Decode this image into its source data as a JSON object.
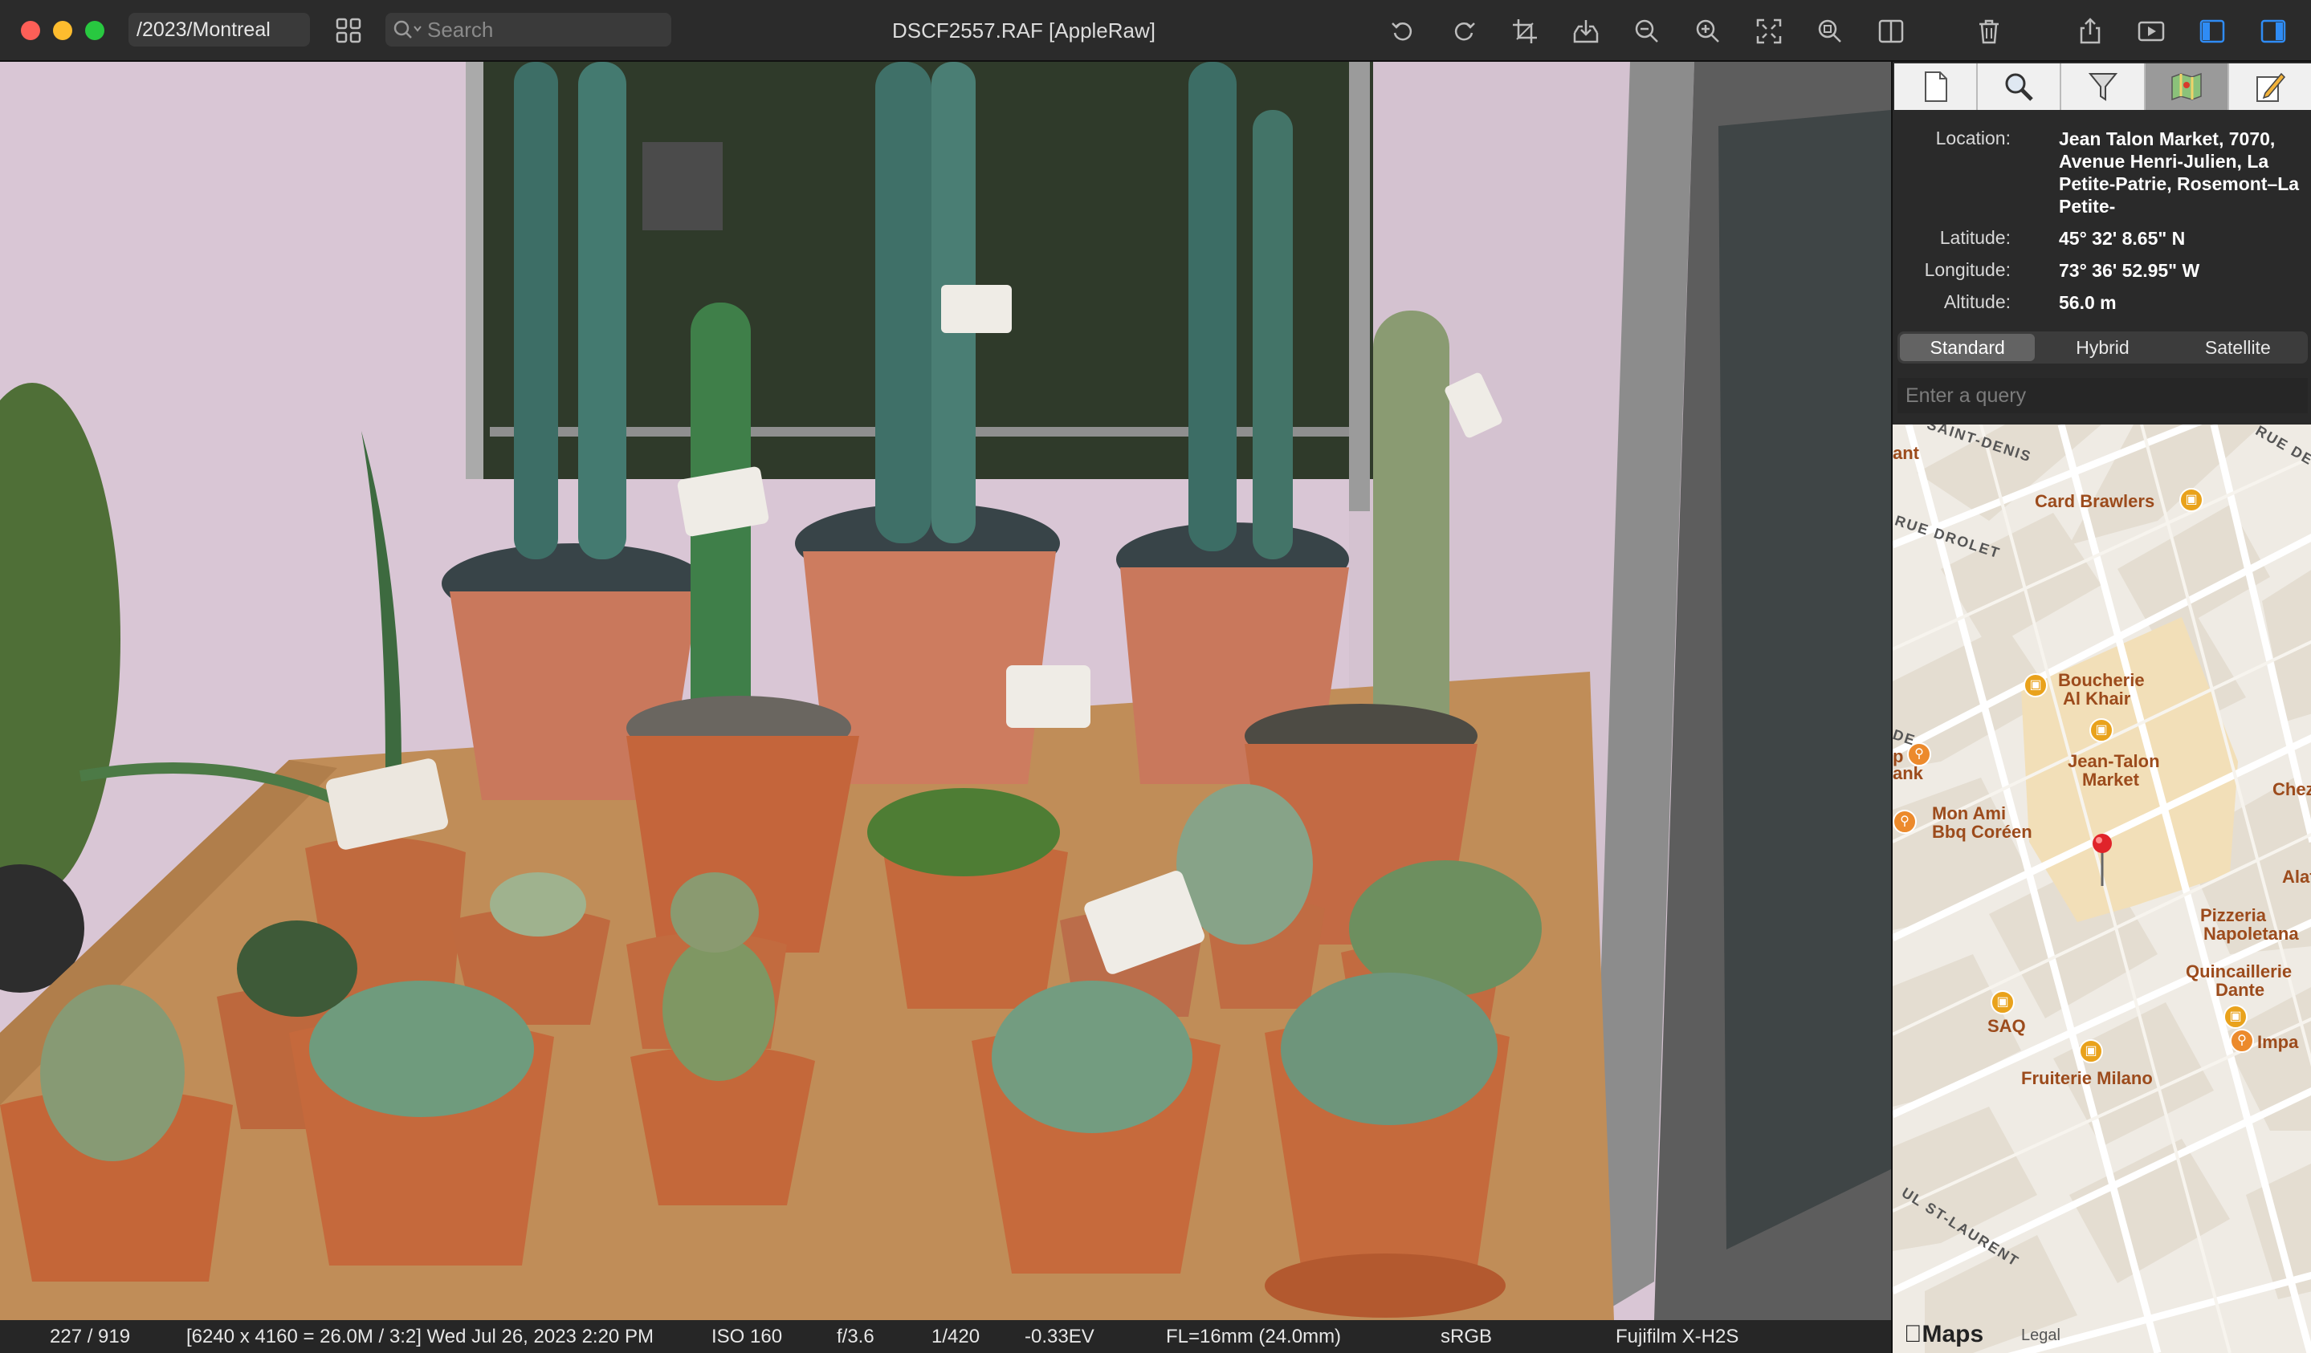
{
  "window": {
    "path": "/2023/Montreal",
    "title": "DSCF2557.RAF [AppleRaw]",
    "search_placeholder": "Search"
  },
  "toolbar": {
    "icons": [
      "rotate-left-icon",
      "rotate-right-icon",
      "crop-icon",
      "save-icon",
      "zoom-out-icon",
      "zoom-in-icon",
      "fit-screen-icon",
      "actual-size-icon",
      "split-view-icon",
      "trash-icon",
      "share-icon",
      "slideshow-icon",
      "left-sidebar-icon",
      "right-sidebar-icon"
    ]
  },
  "status": {
    "index": "227 / 919",
    "dimensions": "[6240 x 4160 = 26.0M / 3:2] Wed Jul 26, 2023  2:20 PM",
    "iso": "ISO 160",
    "aperture": "f/3.6",
    "shutter": "1/420",
    "exposure": "-0.33EV",
    "focal_length": "FL=16mm (24.0mm)",
    "color_space": "sRGB",
    "camera": "Fujifilm X-H2S"
  },
  "panel": {
    "tabs": [
      "file-info-tab",
      "search-tab",
      "filter-tab",
      "map-tab",
      "edit-tab"
    ],
    "location_label": "Location:",
    "location_value": "Jean Talon Market, 7070, Avenue Henri-Julien, La Petite-Patrie, Rosemont–La Petite-",
    "latitude_label": "Latitude:",
    "latitude_value": "45° 32' 8.65\" N",
    "longitude_label": "Longitude:",
    "longitude_value": "73° 36' 52.95\" W",
    "altitude_label": "Altitude:",
    "altitude_value": "56.0 m",
    "map_types": [
      "Standard",
      "Hybrid",
      "Satellite"
    ],
    "selected_map_type": "Standard",
    "query_placeholder": "Enter a query"
  },
  "map": {
    "streets": [
      "SAINT-DENIS",
      "RUE DE",
      "RUE DROLET",
      "DE",
      "UL ST-LAURENT"
    ],
    "pois": {
      "card_brawlers": "Card Brawlers",
      "boucherie_1": "Boucherie",
      "boucherie_2": "Al Khair",
      "jean_talon_1": "Jean-Talon",
      "jean_talon_2": "Market",
      "mon_ami_1": "Mon Ami",
      "mon_ami_2": "Bbq Coréen",
      "chez": "Chez",
      "alat": "Alat",
      "pizzeria_1": "Pizzeria",
      "pizzeria_2": "Napoletana",
      "quincaillerie_1": "Quincaillerie",
      "quincaillerie_2": "Dante",
      "saq": "SAQ",
      "impa": "Impa",
      "fruiterie": "Fruiterie Milano",
      "ant": "ant",
      "ank": "ank",
      "p": "p"
    },
    "brand": "Maps",
    "legal": "Legal"
  }
}
